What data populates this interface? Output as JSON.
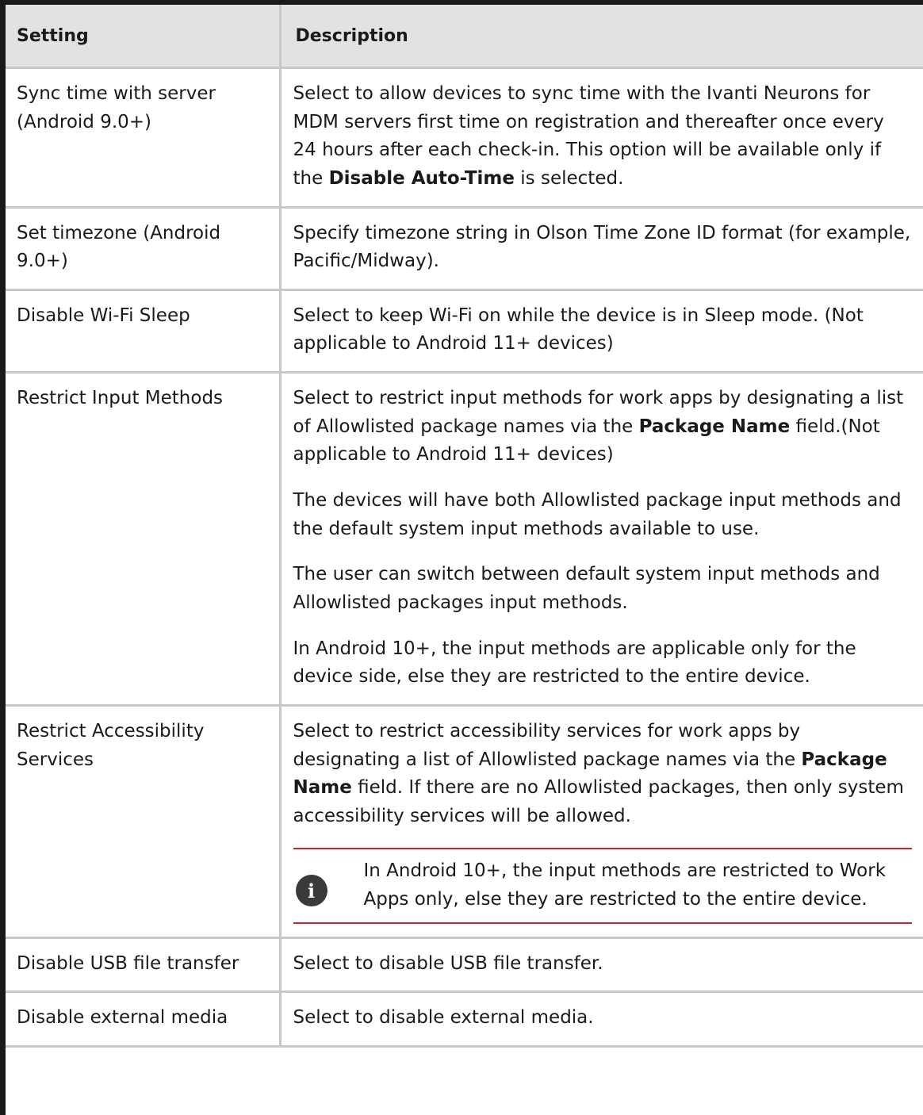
{
  "table": {
    "headers": [
      "Setting",
      "Description"
    ],
    "rows": [
      {
        "setting": "Sync time with server (Android 9.0+)",
        "desc": [
          {
            "parts": [
              "Select to allow devices to sync time with the Ivanti Neurons for MDM servers first time on registration and thereafter once every 24 hours after each check-in. This option will be available only if the ",
              "Disable Auto-Time",
              " is selected."
            ]
          }
        ]
      },
      {
        "setting": "Set timezone (Android 9.0+)",
        "desc": [
          {
            "parts": [
              "Specify timezone string in Olson Time Zone ID format (for example, Pacific/Midway)."
            ]
          }
        ]
      },
      {
        "setting": "Disable Wi-Fi Sleep",
        "desc": [
          {
            "parts": [
              "Select to keep Wi-Fi on while the device is in Sleep mode. (Not applicable to Android 11+ devices)"
            ]
          }
        ]
      },
      {
        "setting": "Restrict Input Methods",
        "desc": [
          {
            "parts": [
              "Select to restrict input methods for work apps by designating a list of Allowlisted package names via the ",
              "Package Name",
              " field.(Not applicable to Android 11+ devices)"
            ]
          },
          {
            "parts": [
              "The devices will have both Allowlisted package input methods and the default system input methods available to use."
            ]
          },
          {
            "parts": [
              "The user can switch between default system input methods and Allowlisted packages input methods."
            ]
          },
          {
            "parts": [
              "In Android 10+, the input methods are applicable only for the device side, else they are restricted to the entire device."
            ]
          }
        ]
      },
      {
        "setting": "Restrict Accessibility Services",
        "desc": [
          {
            "parts": [
              "Select to restrict accessibility services for work apps by designating a list of Allowlisted package names via the ",
              "Package Name",
              " field. If there are no Allowlisted packages, then only system accessibility services will be allowed."
            ]
          }
        ],
        "note": {
          "icon": "info-icon",
          "icon_glyph": "i",
          "text": "In Android 10+, the input methods are restricted to Work Apps only, else they are restricted to the entire device."
        }
      },
      {
        "setting": "Disable USB file transfer",
        "desc": [
          {
            "parts": [
              "Select to disable USB file transfer."
            ]
          }
        ]
      },
      {
        "setting": "Disable external media",
        "desc": [
          {
            "parts": [
              "Select to disable external media."
            ]
          }
        ]
      }
    ]
  },
  "colors": {
    "header_bg": "#e2e2e2",
    "border": "#c8c8c8",
    "frame": "#1a1a1a",
    "note_rule": "#d1232a",
    "note_icon_bg": "#3a3a3a"
  }
}
